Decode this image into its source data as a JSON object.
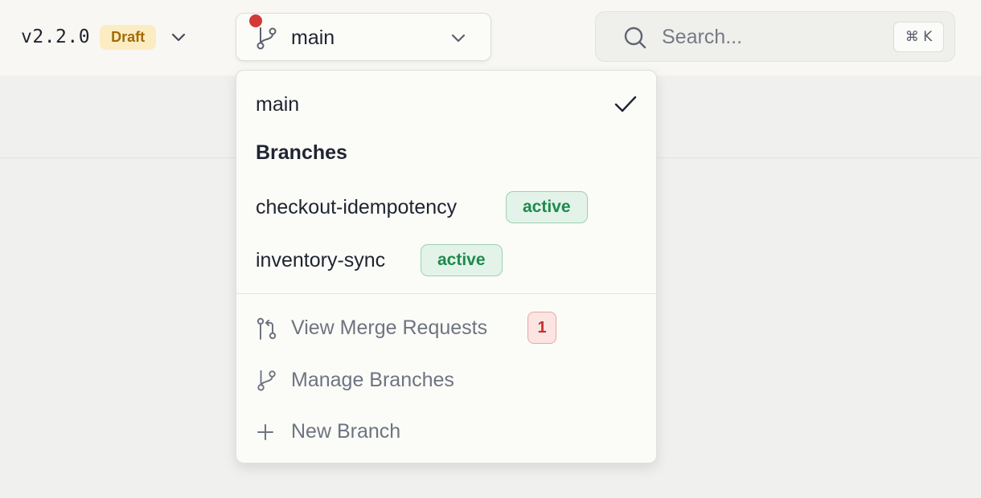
{
  "header": {
    "version": "v2.2.0",
    "draft_badge": "Draft",
    "branch_selector": {
      "current": "main"
    },
    "search": {
      "placeholder": "Search...",
      "shortcut": "⌘ K"
    }
  },
  "dropdown": {
    "current": {
      "label": "main",
      "selected": true
    },
    "branches_heading": "Branches",
    "branches": [
      {
        "name": "checkout-idempotency",
        "status": "active"
      },
      {
        "name": "inventory-sync",
        "status": "active"
      }
    ],
    "actions": {
      "view_merge_requests": {
        "label": "View Merge Requests",
        "count": "1"
      },
      "manage_branches": {
        "label": "Manage Branches"
      },
      "new_branch": {
        "label": "New Branch"
      }
    }
  },
  "colors": {
    "draft_bg": "#fbecc2",
    "draft_text": "#a36a07",
    "active_bg": "#e3f3ea",
    "active_text": "#1f8a4c",
    "alert_dot": "#d23a35",
    "count_bg": "#fbe4e2",
    "count_text": "#c4322c"
  },
  "icons": {
    "version_chevron": "chevron-down-icon",
    "branch": "git-branch-icon",
    "search": "search-icon",
    "check": "check-icon",
    "merge_request": "git-pull-request-icon",
    "add": "plus-icon"
  }
}
